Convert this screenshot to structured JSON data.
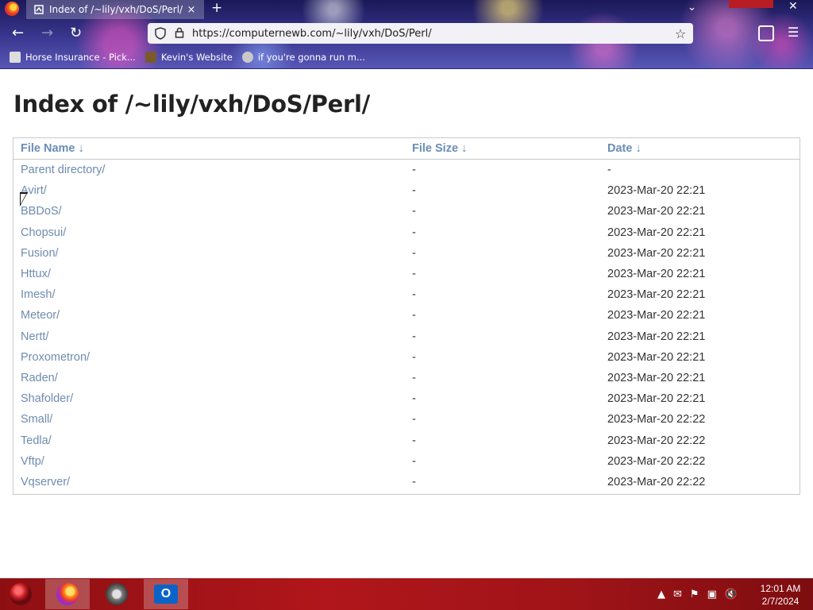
{
  "browser": {
    "tab": {
      "title": "Index of /~lily/vxh/DoS/Perl/",
      "close_icon": "×"
    },
    "new_tab_glyph": "+",
    "url": "https://computernewb.com/~lily/vxh/DoS/Perl/",
    "bookmarks": [
      {
        "label": "Horse Insurance - Pick..."
      },
      {
        "label": "Kevin's Website"
      },
      {
        "label": "if you're gonna run m..."
      }
    ]
  },
  "page": {
    "title": "Index of /~lily/vxh/DoS/Perl/",
    "columns": [
      "File Name",
      "File Size",
      "Date"
    ],
    "sort_arrow": "↓",
    "rows": [
      {
        "name": "Parent directory/",
        "size": "-",
        "date": "-"
      },
      {
        "name": "Avirt/",
        "size": "-",
        "date": "2023-Mar-20 22:21"
      },
      {
        "name": "BBDoS/",
        "size": "-",
        "date": "2023-Mar-20 22:21"
      },
      {
        "name": "Chopsui/",
        "size": "-",
        "date": "2023-Mar-20 22:21"
      },
      {
        "name": "Fusion/",
        "size": "-",
        "date": "2023-Mar-20 22:21"
      },
      {
        "name": "Httux/",
        "size": "-",
        "date": "2023-Mar-20 22:21"
      },
      {
        "name": "Imesh/",
        "size": "-",
        "date": "2023-Mar-20 22:21"
      },
      {
        "name": "Meteor/",
        "size": "-",
        "date": "2023-Mar-20 22:21"
      },
      {
        "name": "Nertt/",
        "size": "-",
        "date": "2023-Mar-20 22:21"
      },
      {
        "name": "Proxometron/",
        "size": "-",
        "date": "2023-Mar-20 22:21"
      },
      {
        "name": "Raden/",
        "size": "-",
        "date": "2023-Mar-20 22:21"
      },
      {
        "name": "Shafolder/",
        "size": "-",
        "date": "2023-Mar-20 22:21"
      },
      {
        "name": "Small/",
        "size": "-",
        "date": "2023-Mar-20 22:22"
      },
      {
        "name": "Tedla/",
        "size": "-",
        "date": "2023-Mar-20 22:22"
      },
      {
        "name": "Vftp/",
        "size": "-",
        "date": "2023-Mar-20 22:22"
      },
      {
        "name": "Vqserver/",
        "size": "-",
        "date": "2023-Mar-20 22:22"
      }
    ]
  },
  "taskbar": {
    "clock_time": "12:01 AM",
    "clock_date": "2/7/2024",
    "outlook_letter": "O"
  },
  "colors": {
    "link": "#6f8bb0",
    "header_link": "#6a8db5",
    "taskbar": "#b0161b"
  }
}
